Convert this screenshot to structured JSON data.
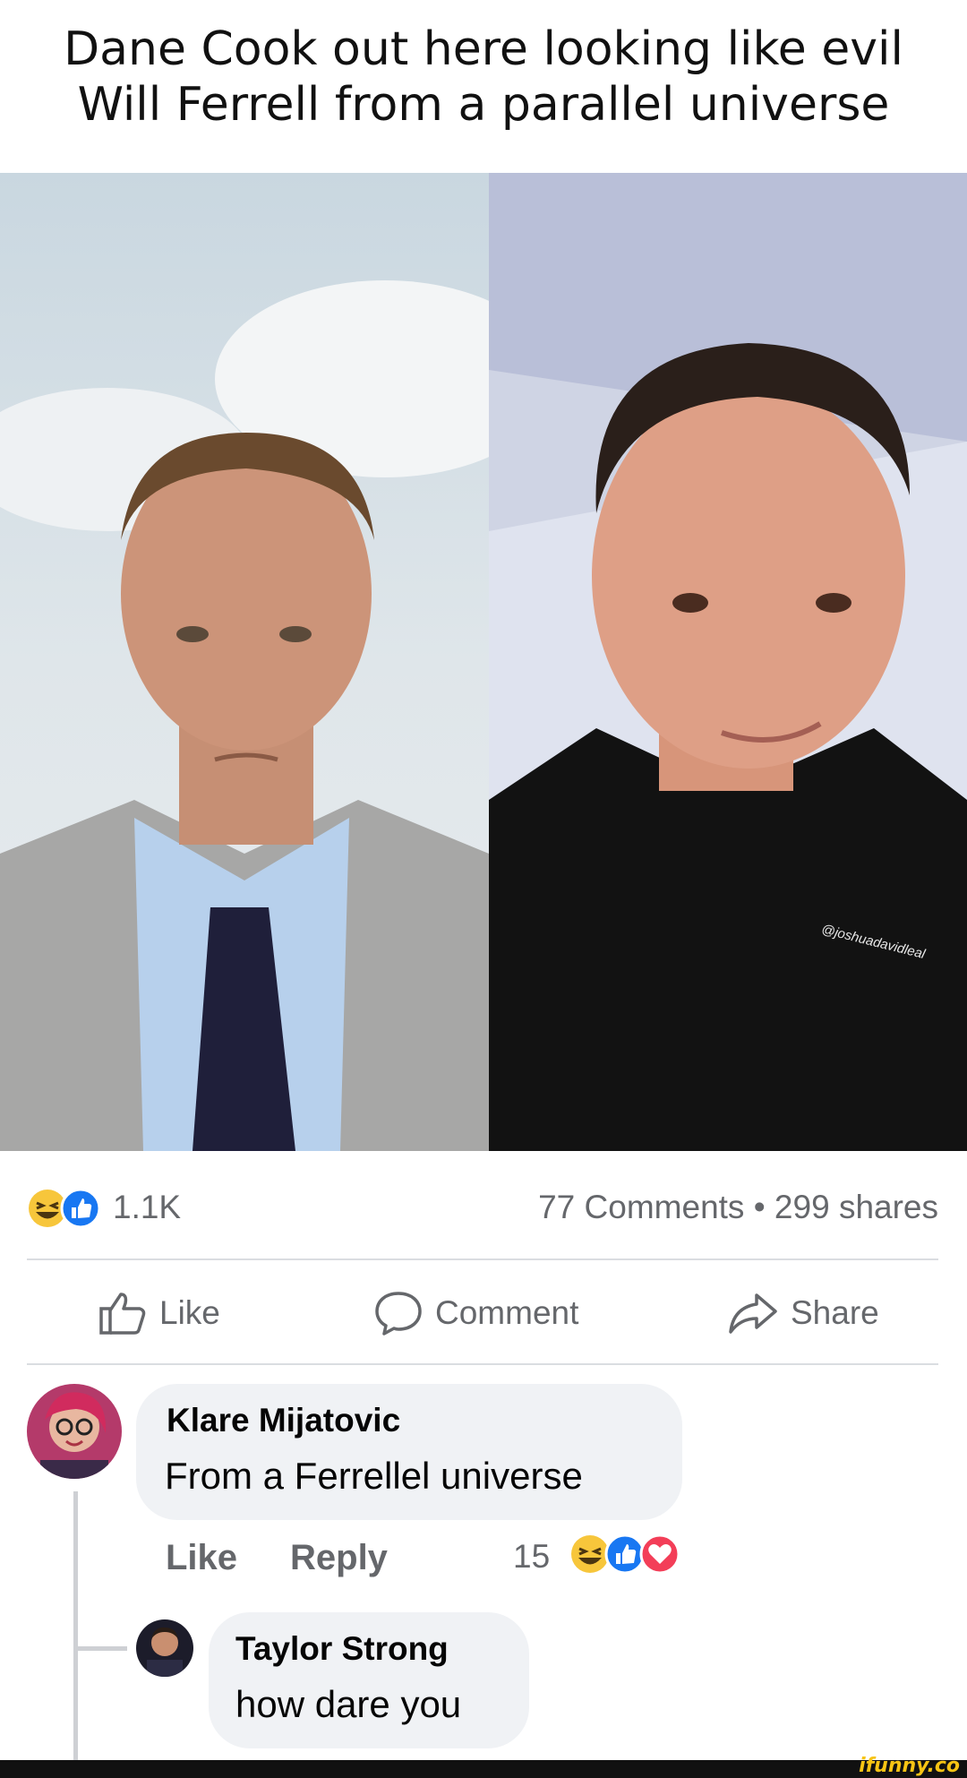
{
  "caption": {
    "line1": "Dane Cook out here looking like evil",
    "line2": "Will Ferrell from a parallel universe"
  },
  "photo_watermark": "@joshuadavidleal",
  "post_stats": {
    "reaction_count": "1.1K",
    "comments_shares": "77 Comments • 299 shares",
    "reaction_icons": [
      "laugh-icon",
      "like-icon"
    ]
  },
  "actions": {
    "like": "Like",
    "comment": "Comment",
    "share": "Share"
  },
  "comments": [
    {
      "author": "Klare Mijatovic",
      "text": "From a Ferrellel universe",
      "like_label": "Like",
      "reply_label": "Reply",
      "reaction_count": "15",
      "reaction_icons": [
        "laugh-icon",
        "like-icon",
        "love-icon"
      ]
    },
    {
      "author": "Taylor Strong",
      "text": "how dare you"
    }
  ],
  "footer": {
    "brand": "ifunny.co"
  },
  "colors": {
    "meta_gray": "#65676b",
    "bubble_bg": "#f0f2f5",
    "like_blue": "#1877f2",
    "laugh_yellow": "#f7c63b",
    "love_red": "#f33e58"
  }
}
